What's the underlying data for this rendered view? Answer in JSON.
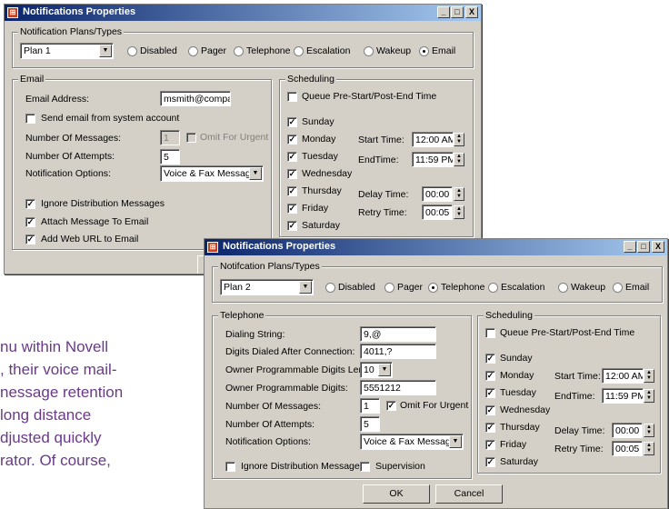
{
  "background_text": [
    "nu within Novell",
    ", their voice mail-",
    "nessage retention",
    "long distance",
    "djusted quickly",
    "rator. Of course,"
  ],
  "window1": {
    "title": "Notifications Properties",
    "controls": [
      "_",
      "□",
      "X"
    ],
    "plans_group": "Notification Plans/Types",
    "plan_select": "Plan 1",
    "types": [
      "Disabled",
      "Pager",
      "Telephone",
      "Escalation",
      "Wakeup",
      "Email"
    ],
    "selected_type": "Email",
    "email": {
      "group": "Email",
      "address_label": "Email Address:",
      "address_value": "msmith@company.cc",
      "send_from_system": "Send email from system account",
      "num_messages_label": "Number Of Messages:",
      "num_messages_value": "1",
      "omit_urgent": "Omit For Urgent",
      "num_attempts_label": "Number Of Attempts:",
      "num_attempts_value": "5",
      "options_label": "Notification Options:",
      "options_value": "Voice & Fax Messages",
      "ignore_dist": "Ignore Distribution Messages",
      "attach": "Attach Message To Email",
      "web_url": "Add Web URL to Email"
    },
    "scheduling": {
      "group": "Scheduling",
      "queue": "Queue Pre-Start/Post-End Time",
      "days": [
        "Sunday",
        "Monday",
        "Tuesday",
        "Wednesday",
        "Thursday",
        "Friday",
        "Saturday"
      ],
      "start_label": "Start Time:",
      "start_value": "12:00 AM",
      "end_label": "EndTime:",
      "end_value": "11:59 PM",
      "delay_label": "Delay Time:",
      "delay_value": "00:00",
      "retry_label": "Retry Time:",
      "retry_value": "00:05"
    }
  },
  "window2": {
    "title": "Notifications Properties",
    "controls": [
      "_",
      "□",
      "X"
    ],
    "plans_group": "Notifcation Plans/Types",
    "plan_select": "Plan 2",
    "types": [
      "Disabled",
      "Pager",
      "Telephone",
      "Escalation",
      "Wakeup",
      "Email"
    ],
    "selected_type": "Telephone",
    "telephone": {
      "group": "Telephone",
      "dialing_label": "Dialing String:",
      "dialing_value": "9,@",
      "digits_after_label": "Digits Dialed After Connection:",
      "digits_after_value": "4011,?",
      "owner_len_label": "Owner Programmable Digits Length:",
      "owner_len_value": "10",
      "owner_digits_label": "Owner Programmable Digits:",
      "owner_digits_value": "5551212",
      "num_messages_label": "Number Of Messages:",
      "num_messages_value": "1",
      "omit_urgent": "Omit For Urgent",
      "num_attempts_label": "Number Of Attempts:",
      "num_attempts_value": "5",
      "options_label": "Notification Options:",
      "options_value": "Voice & Fax Messages",
      "ignore_dist": "Ignore Distribution Messages",
      "supervision": "Supervision"
    },
    "scheduling": {
      "group": "Scheduling",
      "queue": "Queue Pre-Start/Post-End Time",
      "days": [
        "Sunday",
        "Monday",
        "Tuesday",
        "Wednesday",
        "Thursday",
        "Friday",
        "Saturday"
      ],
      "start_label": "Start Time:",
      "start_value": "12:00 AM",
      "end_label": "EndTime:",
      "end_value": "11:59 PM",
      "delay_label": "Delay Time:",
      "delay_value": "00:00",
      "retry_label": "Retry Time:",
      "retry_value": "00:05"
    },
    "ok": "OK",
    "cancel": "Cancel"
  }
}
